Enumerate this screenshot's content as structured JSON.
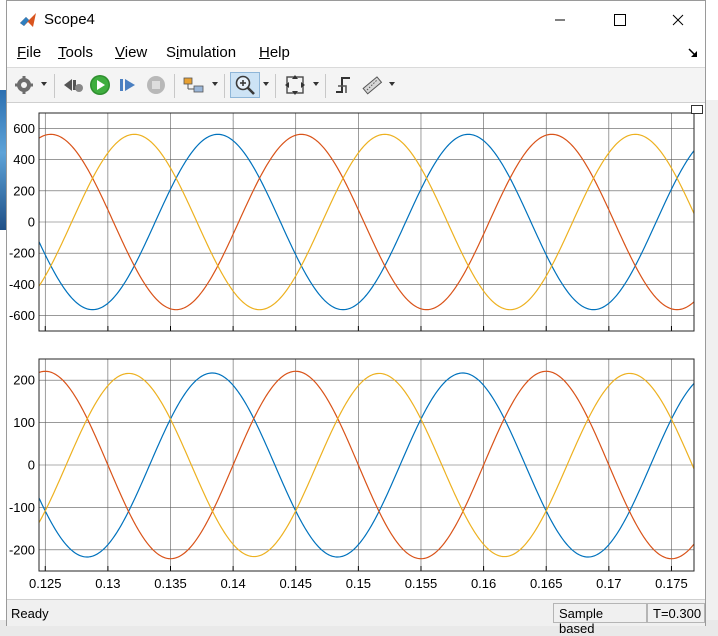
{
  "window": {
    "title": "Scope4"
  },
  "menu": [
    "File",
    "Tools",
    "View",
    "Simulation",
    "Help"
  ],
  "menu_mnemonics": [
    "F",
    "T",
    "V",
    "i",
    "H"
  ],
  "toolbar": {
    "icons": [
      "settings-icon",
      "step-back-icon",
      "run-icon",
      "step-forward-icon",
      "stop-icon",
      "signal-select-icon",
      "zoom-icon",
      "fit-to-view-icon",
      "triggers-icon",
      "measurements-icon"
    ]
  },
  "status": {
    "ready": "Ready",
    "mode": "Sample based",
    "time": "T=0.300"
  },
  "colors": {
    "series_a": "#0072BD",
    "series_b": "#D95319",
    "series_c": "#EDB120",
    "grid": "#5c5c5c",
    "plot_bg": "#ffffff"
  },
  "chart_data": [
    {
      "type": "line",
      "xlim": [
        0.1245,
        0.1768
      ],
      "ylim": [
        -700,
        700
      ],
      "yticks": [
        600,
        400,
        200,
        0,
        -200,
        -400,
        -600
      ],
      "xticks": [
        0.125,
        0.13,
        0.135,
        0.14,
        0.145,
        0.15,
        0.155,
        0.16,
        0.165,
        0.17,
        0.175
      ],
      "grid": true,
      "series": [
        {
          "color": "#0072BD",
          "amplitude": 563,
          "frequency_hz": 50,
          "phase_deg": 112
        },
        {
          "color": "#D95319",
          "amplitude": 563,
          "frequency_hz": 50,
          "phase_deg": -8
        },
        {
          "color": "#EDB120",
          "amplitude": 563,
          "frequency_hz": 50,
          "phase_deg": 232
        }
      ]
    },
    {
      "type": "line",
      "xlim": [
        0.1245,
        0.1768
      ],
      "ylim": [
        -250,
        250
      ],
      "yticks": [
        200,
        100,
        0,
        -100,
        -200
      ],
      "xticks": [
        0.125,
        0.13,
        0.135,
        0.14,
        0.145,
        0.15,
        0.155,
        0.16,
        0.165,
        0.17,
        0.175
      ],
      "xticklabels": [
        "0.125",
        "0.13",
        "0.135",
        "0.14",
        "0.145",
        "0.15",
        "0.155",
        "0.16",
        "0.165",
        "0.17",
        "0.175"
      ],
      "grid": true,
      "series": [
        {
          "color": "#0072BD",
          "amplitude": 217,
          "frequency_hz": 50,
          "phase_deg": 120
        },
        {
          "color": "#D95319",
          "amplitude": 221,
          "frequency_hz": 50,
          "phase_deg": 0
        },
        {
          "color": "#EDB120",
          "amplitude": 216,
          "frequency_hz": 50,
          "phase_deg": 240
        }
      ]
    }
  ]
}
